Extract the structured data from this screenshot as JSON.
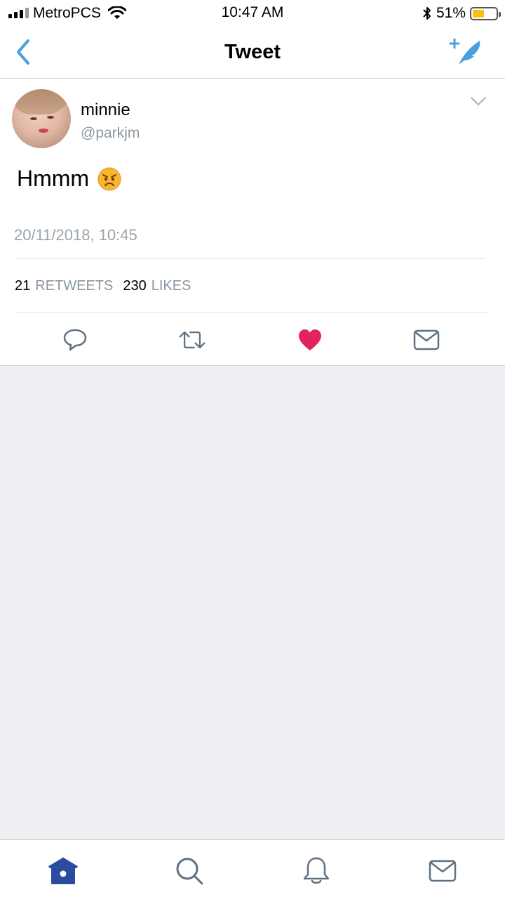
{
  "status_bar": {
    "carrier": "MetroPCS",
    "time": "10:47 AM",
    "battery_percent": "51%",
    "battery_level": 0.51,
    "icons": [
      "signal-icon",
      "wifi-icon",
      "bluetooth-icon",
      "battery-icon"
    ]
  },
  "nav": {
    "title": "Tweet",
    "back_icon": "chevron-left-icon",
    "compose_icon": "compose-tweet-icon",
    "accent_color": "#4AA0DE"
  },
  "tweet": {
    "display_name": "minnie",
    "handle": "@parkjm",
    "text": "Hmmm",
    "emoji": "😠",
    "timestamp": "20/11/2018, 10:45",
    "retweets_count": "21",
    "retweets_label": "RETWEETS",
    "likes_count": "230",
    "likes_label": "LIKES",
    "liked": true,
    "like_color": "#E0245E",
    "actions": [
      "reply-icon",
      "retweet-icon",
      "like-heart-icon",
      "direct-message-icon"
    ]
  },
  "tab_bar": {
    "items": [
      "home-icon",
      "search-icon",
      "notifications-bell-icon",
      "messages-icon"
    ],
    "active": "home-icon",
    "active_color": "#2A4BA0"
  }
}
